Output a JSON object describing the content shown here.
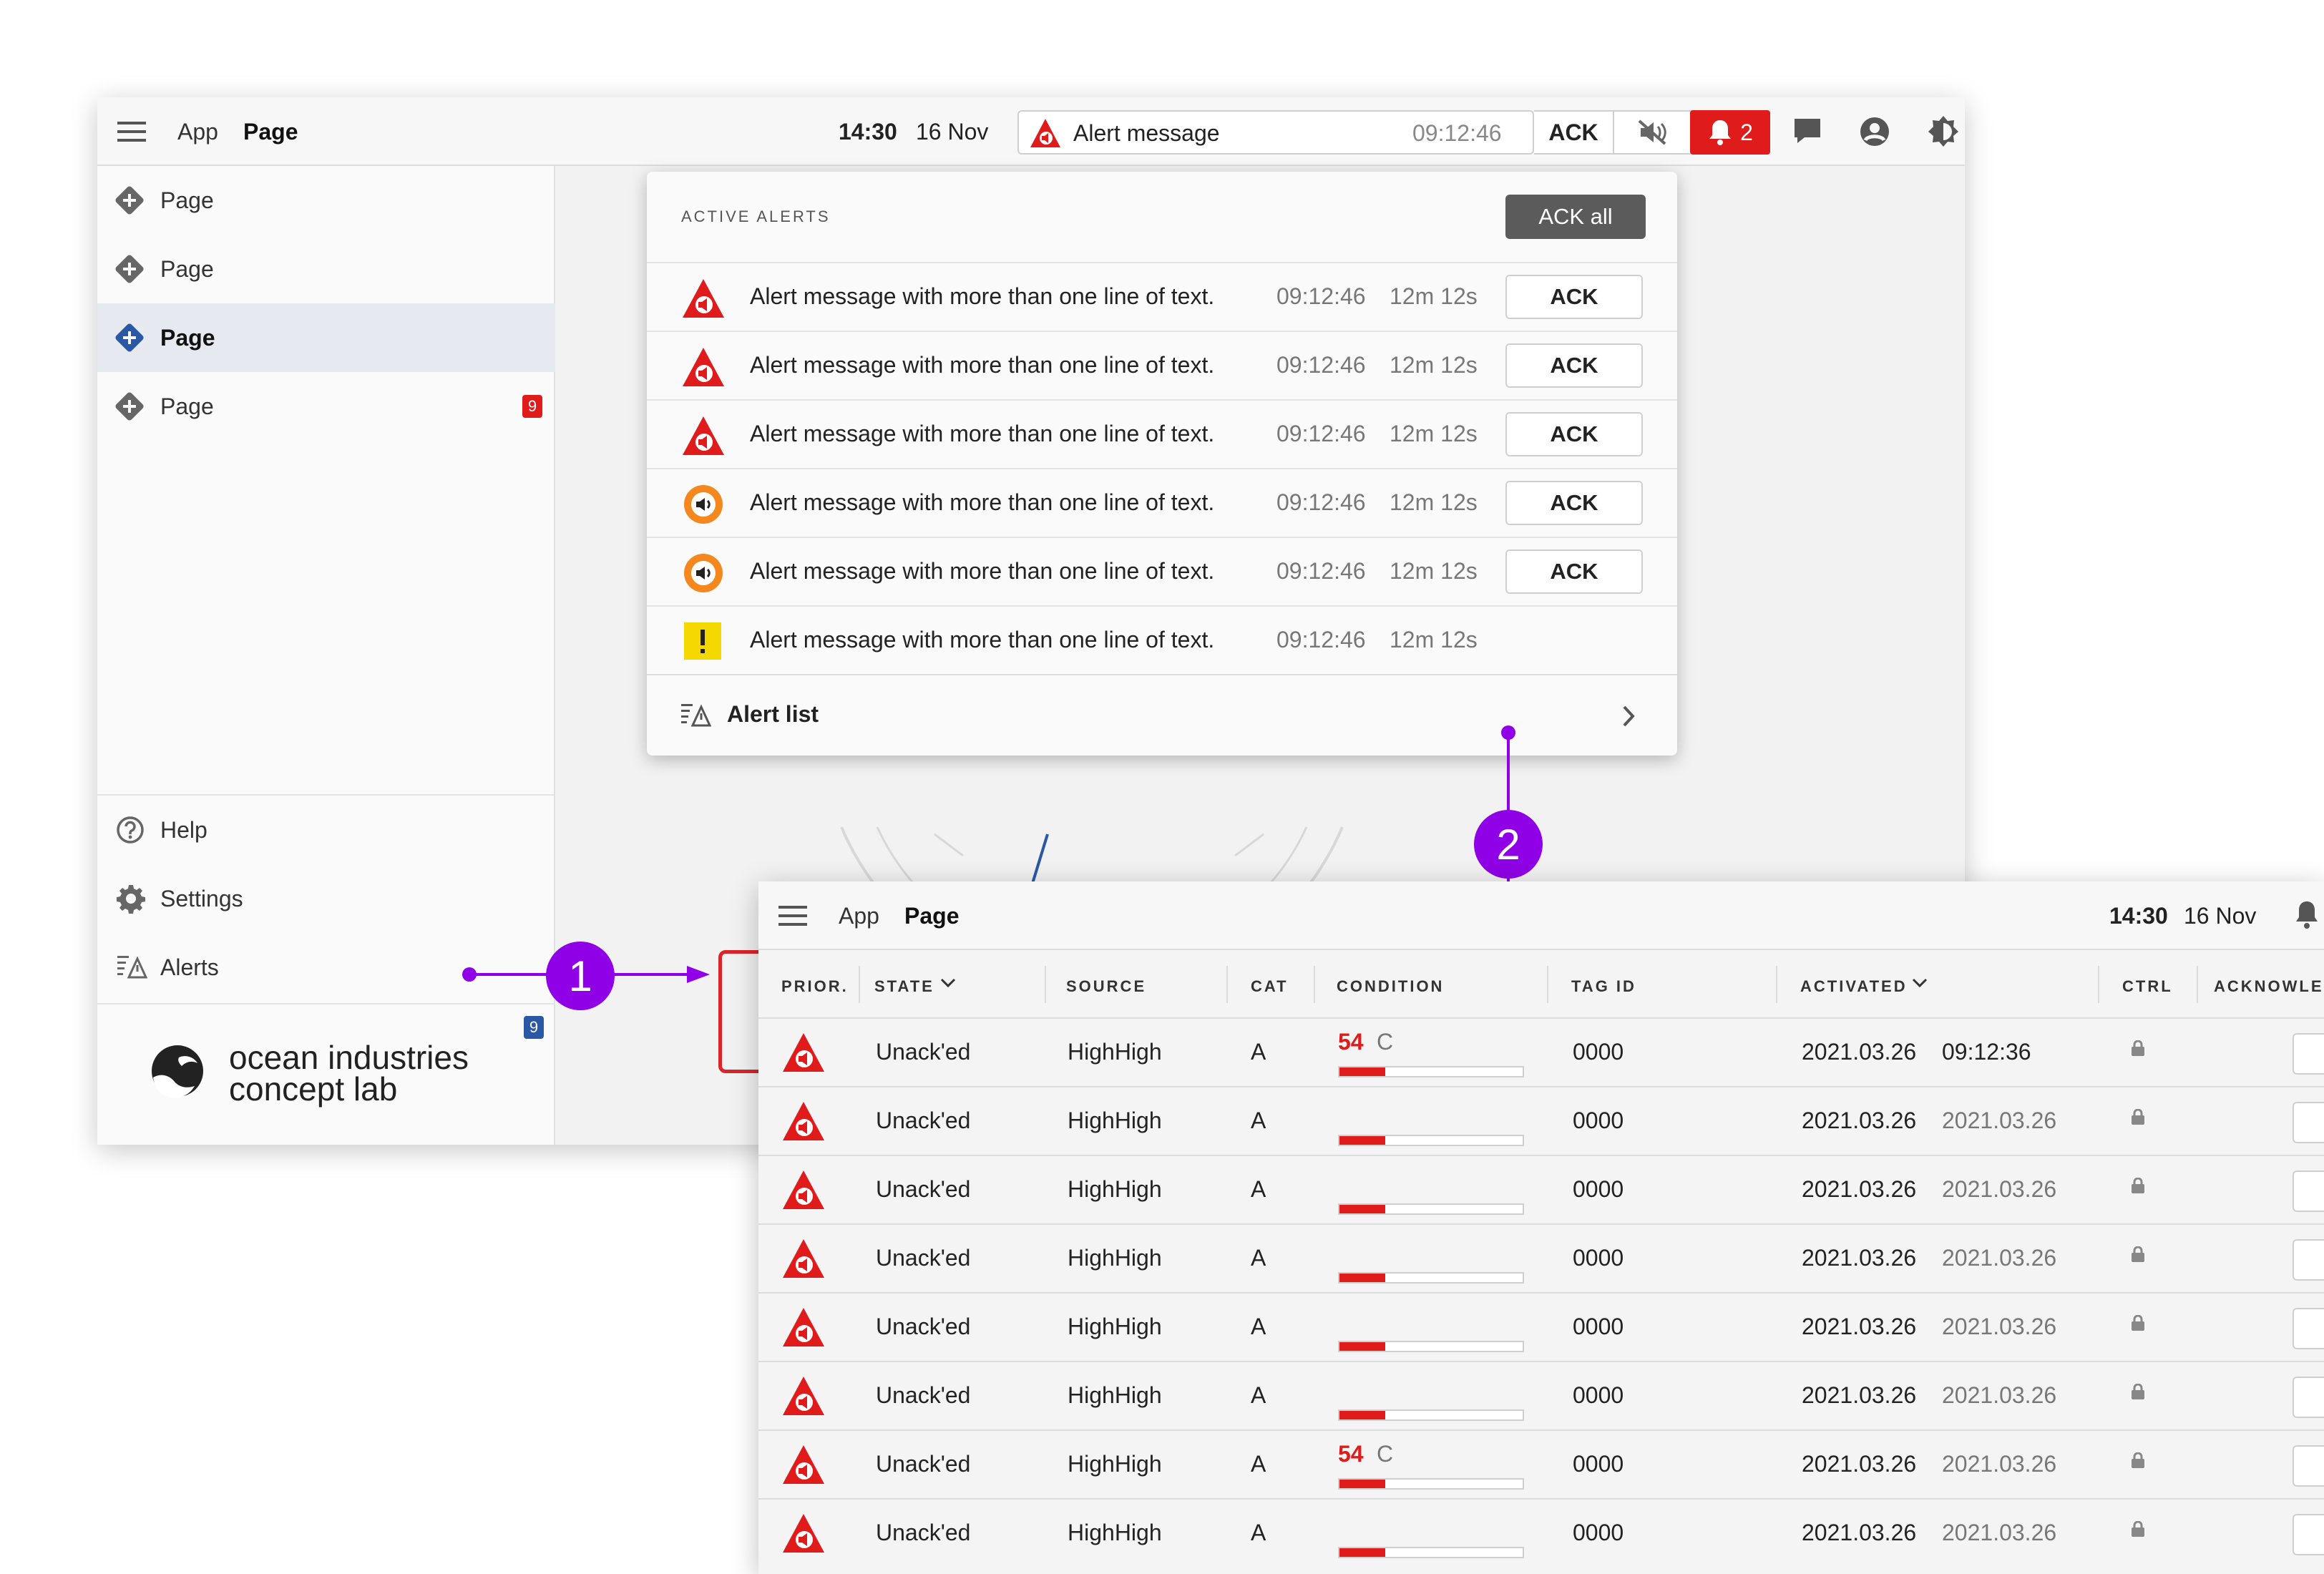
{
  "window1": {
    "topbar": {
      "app": "App",
      "page": "Page",
      "time": "14:30",
      "date": "16 Nov",
      "alert_message": "Alert message",
      "alert_time": "09:12:46",
      "ack_label": "ACK",
      "bell_count": "2"
    },
    "sidebar": {
      "items": [
        {
          "label": "Page",
          "selected": false
        },
        {
          "label": "Page",
          "selected": false
        },
        {
          "label": "Page",
          "selected": true
        },
        {
          "label": "Page",
          "selected": false,
          "badge": "9"
        }
      ],
      "bottom": [
        {
          "label": "Help",
          "icon": "help-icon"
        },
        {
          "label": "Settings",
          "icon": "gear-icon"
        },
        {
          "label": "Alerts",
          "icon": "alert-list-icon"
        }
      ],
      "alerts_badge": "9",
      "logo_line1": "ocean industries",
      "logo_line2": "concept lab"
    }
  },
  "alerts_panel": {
    "title": "ACTIVE ALERTS",
    "ack_all": "ACK all",
    "rows": [
      {
        "icon": "alarm-red",
        "message": "Alert message with more than one line of text.",
        "time": "09:12:46",
        "duration": "12m 12s",
        "ack": "ACK"
      },
      {
        "icon": "alarm-red",
        "message": "Alert message with more than one line of text.",
        "time": "09:12:46",
        "duration": "12m 12s",
        "ack": "ACK"
      },
      {
        "icon": "alarm-red",
        "message": "Alert message with more than one line of text.",
        "time": "09:12:46",
        "duration": "12m 12s",
        "ack": "ACK"
      },
      {
        "icon": "warning-orange",
        "message": "Alert message with more than one line of text.",
        "time": "09:12:46",
        "duration": "12m 12s",
        "ack": "ACK"
      },
      {
        "icon": "warning-orange",
        "message": "Alert message with more than one line of text.",
        "time": "09:12:46",
        "duration": "12m 12s",
        "ack": "ACK"
      },
      {
        "icon": "caution-yellow",
        "message": "Alert message with more than one line of text.",
        "time": "09:12:46",
        "duration": "12m 12s",
        "ack": ""
      }
    ],
    "footer": "Alert list"
  },
  "annotations": {
    "one": "1",
    "two": "2"
  },
  "window2": {
    "topbar": {
      "app": "App",
      "page": "Page",
      "time": "14:30",
      "date": "16 Nov"
    },
    "columns": [
      "PRIOR.",
      "STATE",
      "SOURCE",
      "CAT",
      "CONDITION",
      "TAG ID",
      "ACTIVATED",
      "CTRL",
      "ACKNOWLE"
    ],
    "rows": [
      {
        "state": "Unack'ed",
        "source": "HighHigh",
        "cat": "A",
        "value": "54",
        "unit": "C",
        "fill": 0.25,
        "tag": "0000",
        "date": "2021.03.26",
        "time": "09:12:36"
      },
      {
        "state": "Unack'ed",
        "source": "HighHigh",
        "cat": "A",
        "value": "",
        "unit": "",
        "fill": 0.25,
        "tag": "0000",
        "date": "2021.03.26",
        "time": "2021.03.26"
      },
      {
        "state": "Unack'ed",
        "source": "HighHigh",
        "cat": "A",
        "value": "",
        "unit": "",
        "fill": 0.25,
        "tag": "0000",
        "date": "2021.03.26",
        "time": "2021.03.26"
      },
      {
        "state": "Unack'ed",
        "source": "HighHigh",
        "cat": "A",
        "value": "",
        "unit": "",
        "fill": 0.25,
        "tag": "0000",
        "date": "2021.03.26",
        "time": "2021.03.26"
      },
      {
        "state": "Unack'ed",
        "source": "HighHigh",
        "cat": "A",
        "value": "",
        "unit": "",
        "fill": 0.25,
        "tag": "0000",
        "date": "2021.03.26",
        "time": "2021.03.26"
      },
      {
        "state": "Unack'ed",
        "source": "HighHigh",
        "cat": "A",
        "value": "",
        "unit": "",
        "fill": 0.25,
        "tag": "0000",
        "date": "2021.03.26",
        "time": "2021.03.26"
      },
      {
        "state": "Unack'ed",
        "source": "HighHigh",
        "cat": "A",
        "value": "54",
        "unit": "C",
        "fill": 0.25,
        "tag": "0000",
        "date": "2021.03.26",
        "time": "2021.03.26"
      },
      {
        "state": "Unack'ed",
        "source": "HighHigh",
        "cat": "A",
        "value": "",
        "unit": "",
        "fill": 0.25,
        "tag": "0000",
        "date": "2021.03.26",
        "time": "2021.03.26"
      }
    ]
  },
  "colors": {
    "alarm": "#e01b1b",
    "warning": "#f5871f",
    "caution": "#f5d800",
    "annotation": "#9000e6",
    "selected": "#2a58a4"
  }
}
